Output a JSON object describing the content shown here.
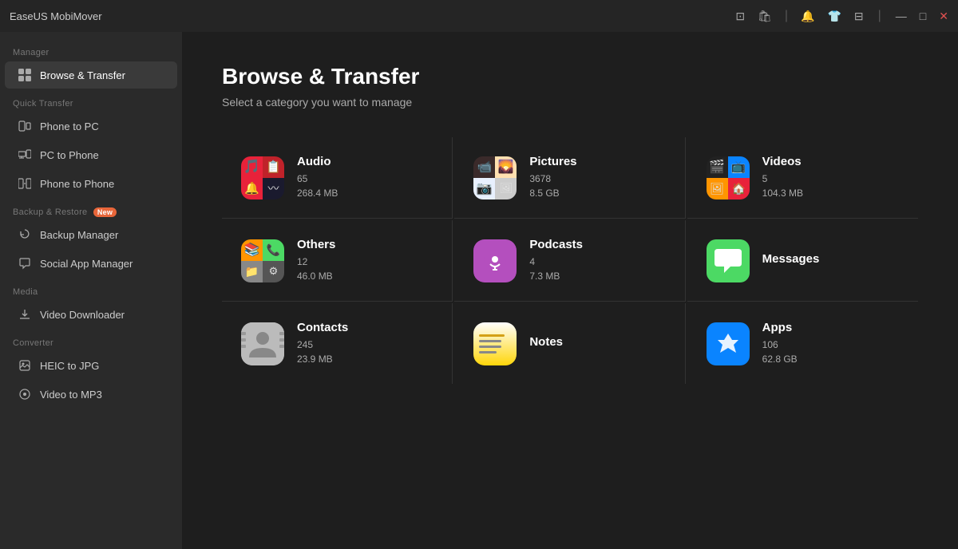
{
  "app": {
    "title": "EaseUS MobiMover"
  },
  "titlebar": {
    "controls": [
      "device-icon",
      "bag-icon",
      "bell-icon",
      "tshirt-icon",
      "expand-icon",
      "minimize-icon",
      "maximize-icon",
      "close-icon"
    ]
  },
  "sidebar": {
    "sections": [
      {
        "label": "Manager",
        "items": [
          {
            "id": "browse-transfer",
            "label": "Browse & Transfer",
            "icon": "⊞",
            "active": true
          }
        ]
      },
      {
        "label": "Quick Transfer",
        "items": [
          {
            "id": "phone-to-pc",
            "label": "Phone to PC",
            "icon": "📱"
          },
          {
            "id": "pc-to-phone",
            "label": "PC to Phone",
            "icon": "💻"
          },
          {
            "id": "phone-to-phone",
            "label": "Phone to Phone",
            "icon": "📲"
          }
        ]
      },
      {
        "label": "Backup & Restore",
        "badge": "New",
        "items": [
          {
            "id": "backup-manager",
            "label": "Backup Manager",
            "icon": "🔄"
          },
          {
            "id": "social-app-manager",
            "label": "Social App Manager",
            "icon": "💬"
          }
        ]
      },
      {
        "label": "Media",
        "items": [
          {
            "id": "video-downloader",
            "label": "Video Downloader",
            "icon": "⬇"
          }
        ]
      },
      {
        "label": "Converter",
        "items": [
          {
            "id": "heic-to-jpg",
            "label": "HEIC to JPG",
            "icon": "🖼"
          },
          {
            "id": "video-to-mp3",
            "label": "Video to MP3",
            "icon": "🎵"
          }
        ]
      }
    ]
  },
  "content": {
    "title": "Browse & Transfer",
    "subtitle": "Select a category you want to manage",
    "categories": [
      {
        "id": "audio",
        "name": "Audio",
        "count": "65",
        "size": "268.4 MB",
        "icon_type": "multi"
      },
      {
        "id": "pictures",
        "name": "Pictures",
        "count": "3678",
        "size": "8.5 GB",
        "icon_type": "multi"
      },
      {
        "id": "videos",
        "name": "Videos",
        "count": "5",
        "size": "104.3 MB",
        "icon_type": "multi"
      },
      {
        "id": "others",
        "name": "Others",
        "count": "12",
        "size": "46.0 MB",
        "icon_type": "multi"
      },
      {
        "id": "podcasts",
        "name": "Podcasts",
        "count": "4",
        "size": "7.3 MB",
        "icon_type": "single",
        "bg": "#b44fbe"
      },
      {
        "id": "messages",
        "name": "Messages",
        "count": "",
        "size": "",
        "icon_type": "messages"
      },
      {
        "id": "contacts",
        "name": "Contacts",
        "count": "245",
        "size": "23.9 MB",
        "icon_type": "contacts"
      },
      {
        "id": "notes",
        "name": "Notes",
        "count": "",
        "size": "",
        "icon_type": "notes"
      },
      {
        "id": "apps",
        "name": "Apps",
        "count": "106",
        "size": "62.8 GB",
        "icon_type": "apps"
      }
    ]
  }
}
